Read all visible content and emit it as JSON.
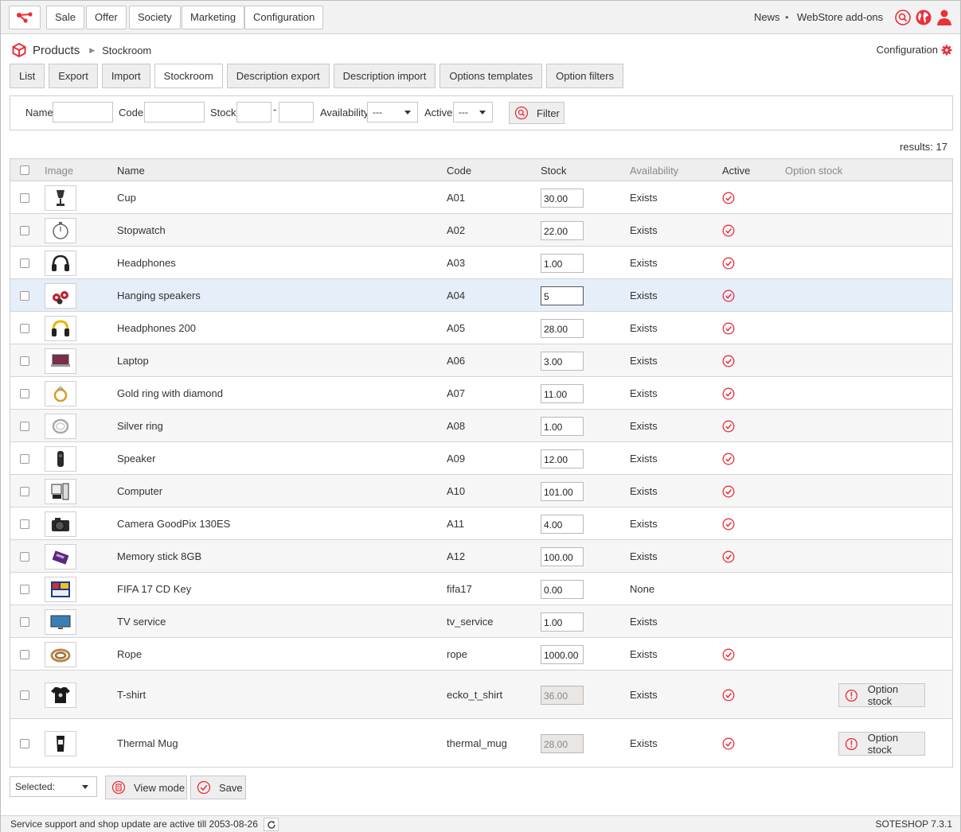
{
  "topbar": {
    "menu": [
      "Sale",
      "Offer",
      "Society",
      "Marketing",
      "Configuration"
    ],
    "news": "News",
    "separator": "•",
    "addons": "WebStore add-ons"
  },
  "breadcrumb": {
    "title": "Products",
    "current": "Stockroom"
  },
  "config_link": "Configuration",
  "tabs": [
    "List",
    "Export",
    "Import",
    "Stockroom",
    "Description export",
    "Description import",
    "Options templates",
    "Option filters"
  ],
  "active_tab": "Stockroom",
  "filter": {
    "name_label": "Name",
    "code_label": "Code",
    "stock_label": "Stock",
    "range_sep": "-",
    "availability_label": "Availability",
    "availability_value": "---",
    "active_label": "Active",
    "active_value": "---",
    "button": "Filter"
  },
  "results": "results: 17",
  "columns": {
    "image": "Image",
    "name": "Name",
    "code": "Code",
    "stock": "Stock",
    "availability": "Availability",
    "active": "Active",
    "option_stock": "Option stock"
  },
  "rows": [
    {
      "name": "Cup",
      "code": "A01",
      "stock": "30.00",
      "availability": "Exists",
      "active": true,
      "thumb": "cup"
    },
    {
      "name": "Stopwatch",
      "code": "A02",
      "stock": "22.00",
      "availability": "Exists",
      "active": true,
      "thumb": "stopwatch"
    },
    {
      "name": "Headphones",
      "code": "A03",
      "stock": "1.00",
      "availability": "Exists",
      "active": true,
      "thumb": "headphones"
    },
    {
      "name": "Hanging speakers",
      "code": "A04",
      "stock": "5",
      "availability": "Exists",
      "active": true,
      "thumb": "speakers",
      "highlight": true
    },
    {
      "name": "Headphones 200",
      "code": "A05",
      "stock": "28.00",
      "availability": "Exists",
      "active": true,
      "thumb": "headphones-yellow"
    },
    {
      "name": "Laptop",
      "code": "A06",
      "stock": "3.00",
      "availability": "Exists",
      "active": true,
      "thumb": "laptop"
    },
    {
      "name": "Gold ring with diamond",
      "code": "A07",
      "stock": "11.00",
      "availability": "Exists",
      "active": true,
      "thumb": "gold-ring"
    },
    {
      "name": "Silver ring",
      "code": "A08",
      "stock": "1.00",
      "availability": "Exists",
      "active": true,
      "thumb": "silver-ring"
    },
    {
      "name": "Speaker",
      "code": "A09",
      "stock": "12.00",
      "availability": "Exists",
      "active": true,
      "thumb": "speaker"
    },
    {
      "name": "Computer",
      "code": "A10",
      "stock": "101.00",
      "availability": "Exists",
      "active": true,
      "thumb": "computer"
    },
    {
      "name": "Camera GoodPix 130ES",
      "code": "A11",
      "stock": "4.00",
      "availability": "Exists",
      "active": true,
      "thumb": "camera"
    },
    {
      "name": "Memory stick 8GB",
      "code": "A12",
      "stock": "100.00",
      "availability": "Exists",
      "active": true,
      "thumb": "memory-stick"
    },
    {
      "name": "FIFA 17 CD Key",
      "code": "fifa17",
      "stock": "0.00",
      "availability": "None",
      "active": false,
      "thumb": "fifa"
    },
    {
      "name": "TV service",
      "code": "tv_service",
      "stock": "1.00",
      "availability": "Exists",
      "active": false,
      "thumb": "tv"
    },
    {
      "name": "Rope",
      "code": "rope",
      "stock": "1000.00",
      "availability": "Exists",
      "active": true,
      "thumb": "rope"
    },
    {
      "name": "T-shirt",
      "code": "ecko_t_shirt",
      "stock": "36.00",
      "availability": "Exists",
      "active": true,
      "thumb": "tshirt",
      "option_stock": "Option stock",
      "disabled": true
    },
    {
      "name": "Thermal Mug",
      "code": "thermal_mug",
      "stock": "28.00",
      "availability": "Exists",
      "active": true,
      "thumb": "thermal-mug",
      "option_stock": "Option stock",
      "disabled": true
    }
  ],
  "bottom": {
    "selected": "Selected:",
    "view_mode": "View mode",
    "save": "Save"
  },
  "footer": {
    "support": "Service support and shop update are active till 2053-08-26",
    "version": "SOTESHOP 7.3.1"
  },
  "colors": {
    "accent": "#e8303a",
    "highlight_row": "#e6eefa"
  }
}
